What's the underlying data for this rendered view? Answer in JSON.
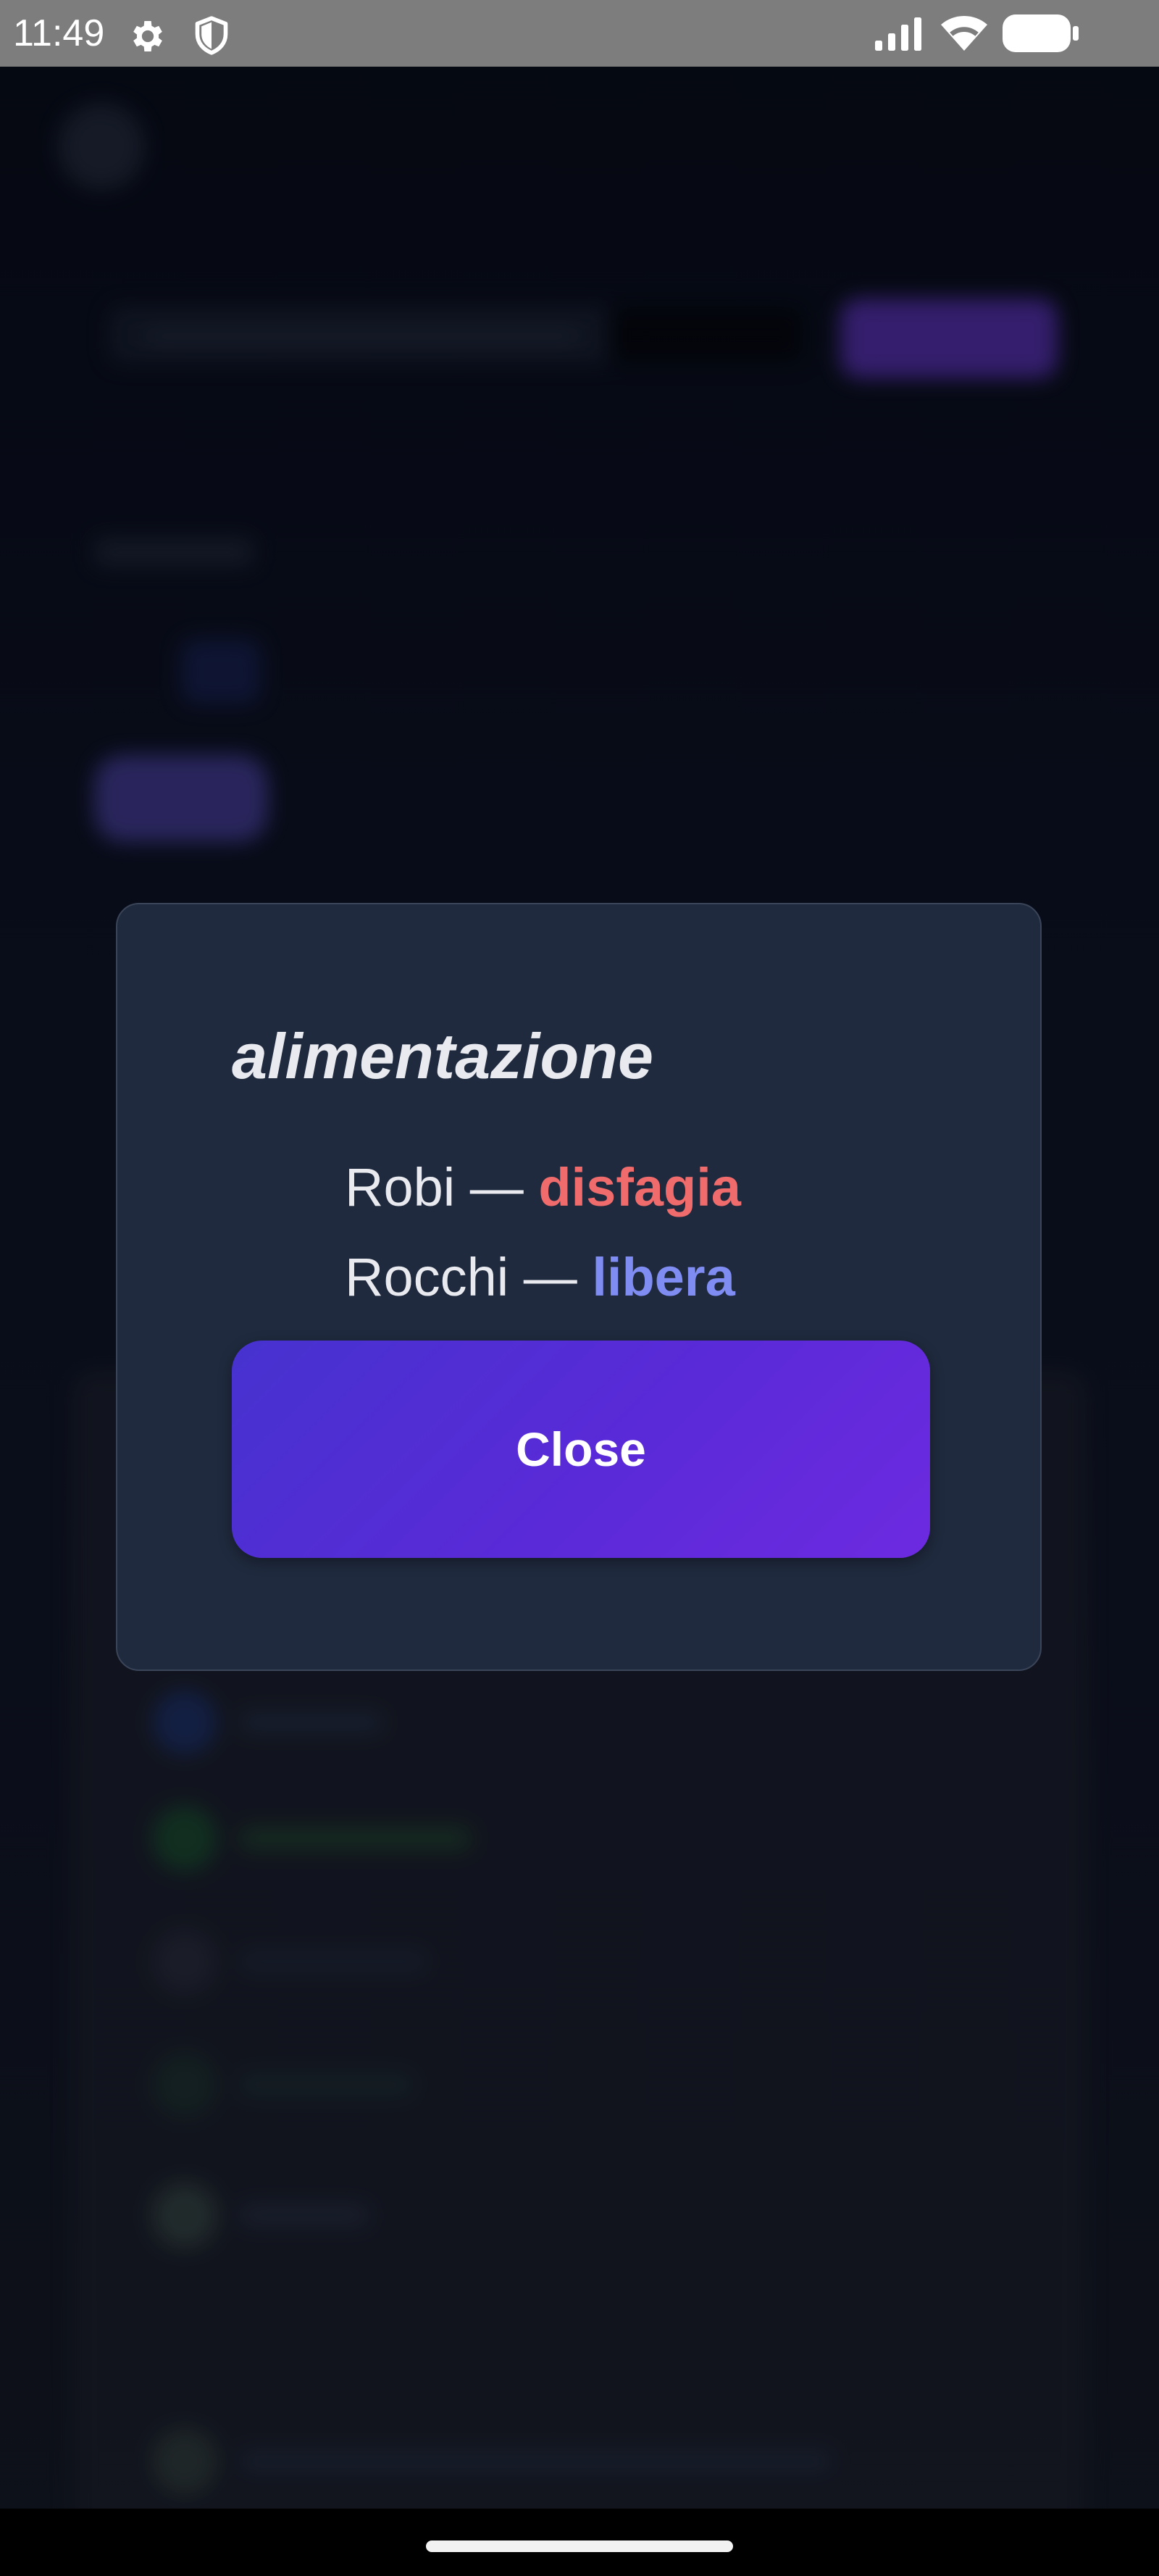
{
  "status_bar": {
    "time": "11:49",
    "icons": [
      "gear-icon",
      "shield-icon",
      "signal-icon",
      "wifi-icon",
      "battery-icon"
    ]
  },
  "modal": {
    "title": "alimentazione",
    "entries": [
      {
        "name": "Robi",
        "separator": " — ",
        "value": "disfagia",
        "value_color": "#f06b6b"
      },
      {
        "name": "Rocchi",
        "separator": " — ",
        "value": "libera",
        "value_color": "#7f8cf2"
      }
    ],
    "close_label": "Close"
  },
  "colors": {
    "accent_start": "#4632cf",
    "accent_end": "#6d2ae0",
    "modal_background": "#1f2a3e",
    "text": "#e8eaef"
  }
}
